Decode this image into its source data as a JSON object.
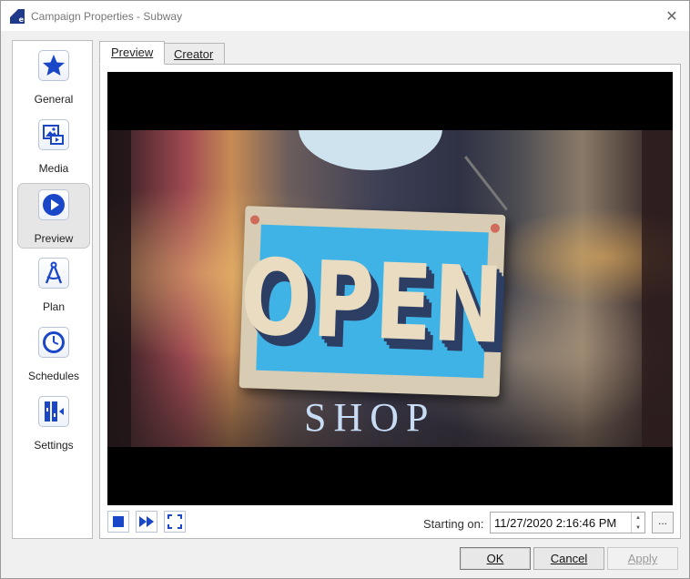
{
  "window": {
    "title": "Campaign Properties - Subway"
  },
  "sidebar": {
    "items": [
      {
        "label": "General",
        "icon": "star-icon",
        "active": false
      },
      {
        "label": "Media",
        "icon": "media-icon",
        "active": false
      },
      {
        "label": "Preview",
        "icon": "play-icon",
        "active": true
      },
      {
        "label": "Plan",
        "icon": "compass-icon",
        "active": false
      },
      {
        "label": "Schedules",
        "icon": "clock-icon",
        "active": false
      },
      {
        "label": "Settings",
        "icon": "settings-icon",
        "active": false
      }
    ]
  },
  "tabs": [
    {
      "label": "Preview",
      "active": true
    },
    {
      "label": "Creator",
      "active": false
    }
  ],
  "preview": {
    "sign_text": "OPEN",
    "shop_text": "SHOP"
  },
  "controls": {
    "stop_icon": "stop-icon",
    "fast_forward_icon": "fast-forward-icon",
    "fullscreen_icon": "fullscreen-icon",
    "starting_label": "Starting on:",
    "starting_value": "11/27/2020 2:16:46 PM",
    "browse_label": "..."
  },
  "buttons": {
    "ok": "OK",
    "cancel": "Cancel",
    "apply": "Apply"
  },
  "colors": {
    "accent": "#1a46c8",
    "sign_blue": "#3fb3e6"
  }
}
